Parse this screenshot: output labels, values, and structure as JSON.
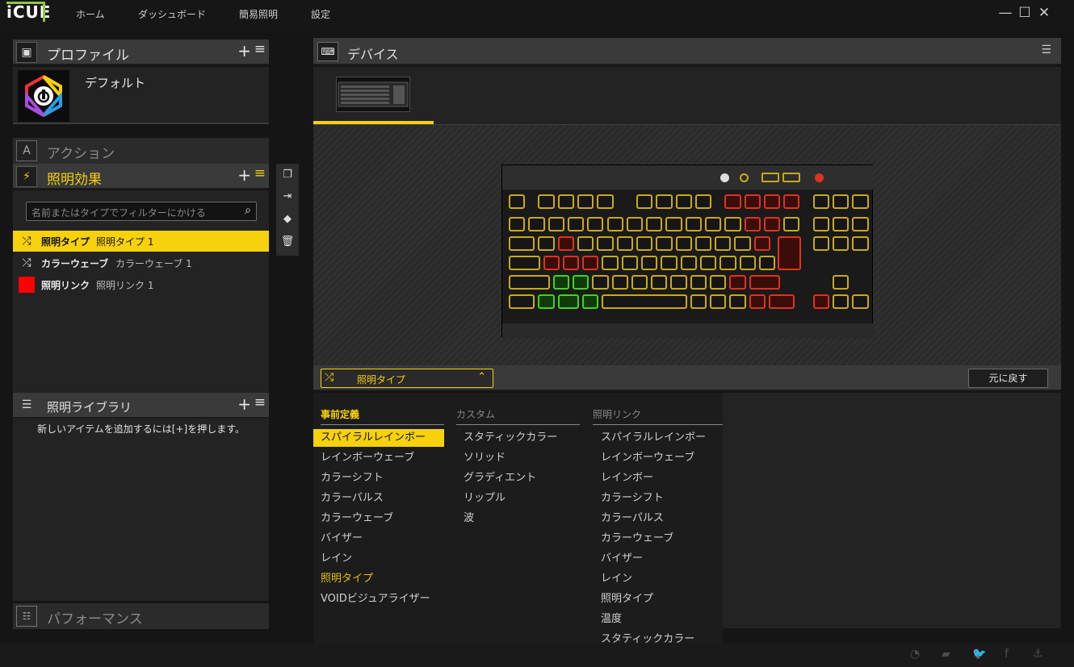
{
  "app": {
    "logo": "iCUE"
  },
  "nav": [
    "ホーム",
    "ダッシュボード",
    "簡易照明",
    "設定"
  ],
  "window": {
    "minimize": "—",
    "maximize": "☐",
    "close": "✕"
  },
  "profile": {
    "title": "プロファイル",
    "add": "+",
    "menu": "≡",
    "name": "デフォルト"
  },
  "actions": {
    "title": "アクション"
  },
  "lighting": {
    "title": "照明効果",
    "add": "+",
    "menu": "≡",
    "filter_placeholder": "名前またはタイプでフィルターにかける",
    "effects": [
      {
        "name": "照明タイプ",
        "sub": "照明タイプ 1"
      },
      {
        "name": "カラーウェーブ",
        "sub": "カラーウェーブ 1"
      },
      {
        "name": "照明リンク",
        "sub": "照明リンク 1"
      }
    ]
  },
  "library": {
    "title": "照明ライブラリ",
    "add": "+",
    "menu": "≡",
    "message": "新しいアイテムを追加するには[+]を押します。"
  },
  "performance": {
    "title": "パフォーマンス"
  },
  "devices": {
    "title": "デバイス"
  },
  "effect_bar": {
    "selected": "照明タイプ",
    "reset": "元に戻す"
  },
  "dropdown": {
    "columns": [
      {
        "header": "事前定義",
        "items": [
          "スパイラルレインボー",
          "レインボーウェーブ",
          "カラーシフト",
          "カラーパルス",
          "カラーウェーブ",
          "バイザー",
          "レイン",
          "照明タイプ",
          "VOIDビジュアライザー"
        ]
      },
      {
        "header": "カスタム",
        "items": [
          "スタティックカラー",
          "ソリッド",
          "グラディエント",
          "リップル",
          "波"
        ]
      },
      {
        "header": "照明リンク",
        "items": [
          "スパイラルレインボー",
          "レインボーウェーブ",
          "レインボー",
          "カラーシフト",
          "カラーパルス",
          "カラーウェーブ",
          "バイザー",
          "レイン",
          "照明タイプ",
          "温度",
          "スタティックカラー"
        ]
      }
    ]
  },
  "colors": {
    "accent": "#f7d10c",
    "brand_green": "#8ec63f",
    "key_yellow": "#c9a91b",
    "key_red": "#e0321c",
    "key_green": "#43d31a"
  }
}
